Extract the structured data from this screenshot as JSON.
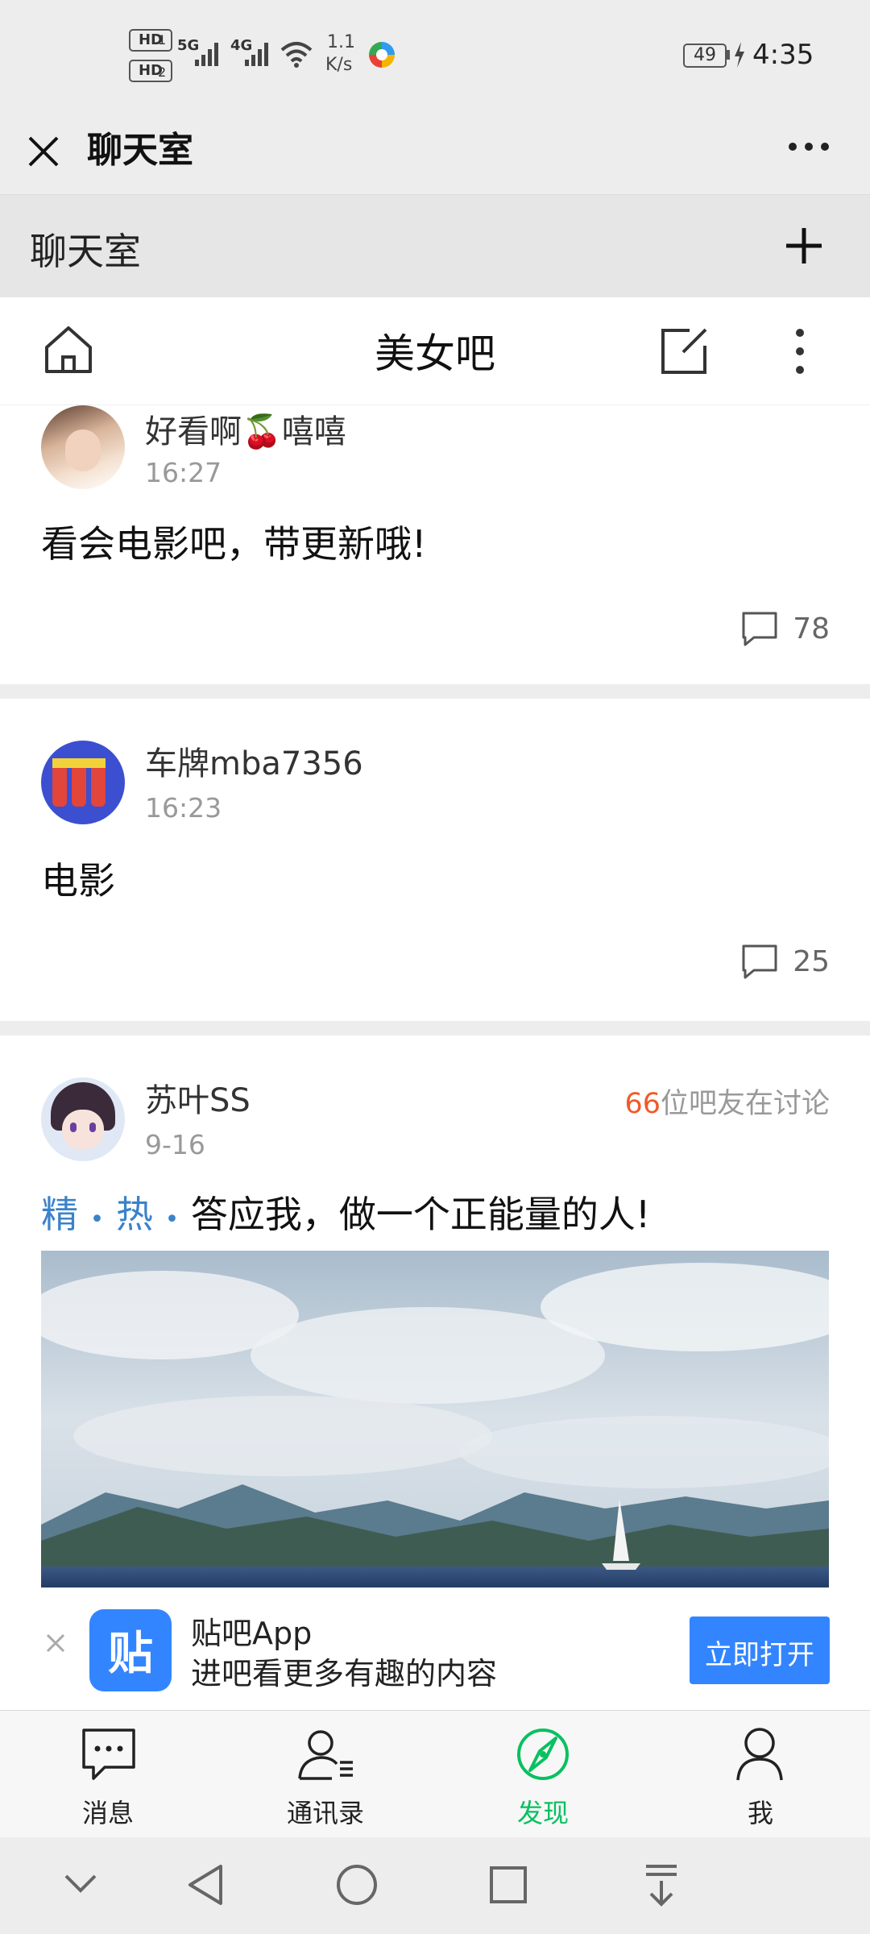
{
  "status_bar": {
    "hd1": "HD",
    "hd2": "HD",
    "sim1_sup": "1",
    "sim2_sup": "2",
    "net1": "5G",
    "net2": "4G",
    "speed_value": "1.1",
    "speed_unit": "K/s",
    "battery": "49",
    "time": "4:35"
  },
  "title_bar": {
    "title": "聊天室"
  },
  "sub_header": {
    "title": "聊天室"
  },
  "tieba_header": {
    "title": "美女吧"
  },
  "posts": [
    {
      "user": "好看啊🍒嘻嘻",
      "time": "16:27",
      "text": "看会电影吧，带更新哦!",
      "comments": "78"
    },
    {
      "user": "车牌mba7356",
      "time": "16:23",
      "text": "电影",
      "comments": "25"
    },
    {
      "user": "苏叶SS",
      "time": "9-16",
      "discuss_count": "66",
      "discuss_text": "位吧友在讨论",
      "tag1": "精",
      "tag_dot": "•",
      "tag2": "热",
      "text": "答应我，做一个正能量的人!"
    }
  ],
  "app_banner": {
    "logo_char": "贴",
    "title": "贴吧App",
    "subtitle": "进吧看更多有趣的内容",
    "open_button": "立即打开"
  },
  "bottom_nav": {
    "items": [
      {
        "label": "消息",
        "icon": "chat-bubble-icon"
      },
      {
        "label": "通讯录",
        "icon": "contacts-icon"
      },
      {
        "label": "发现",
        "icon": "compass-icon"
      },
      {
        "label": "我",
        "icon": "person-icon"
      }
    ]
  },
  "colors": {
    "accent_green": "#07c160",
    "tag_blue": "#3b82c9",
    "orange": "#f05a28",
    "button_blue": "#3385ff"
  }
}
